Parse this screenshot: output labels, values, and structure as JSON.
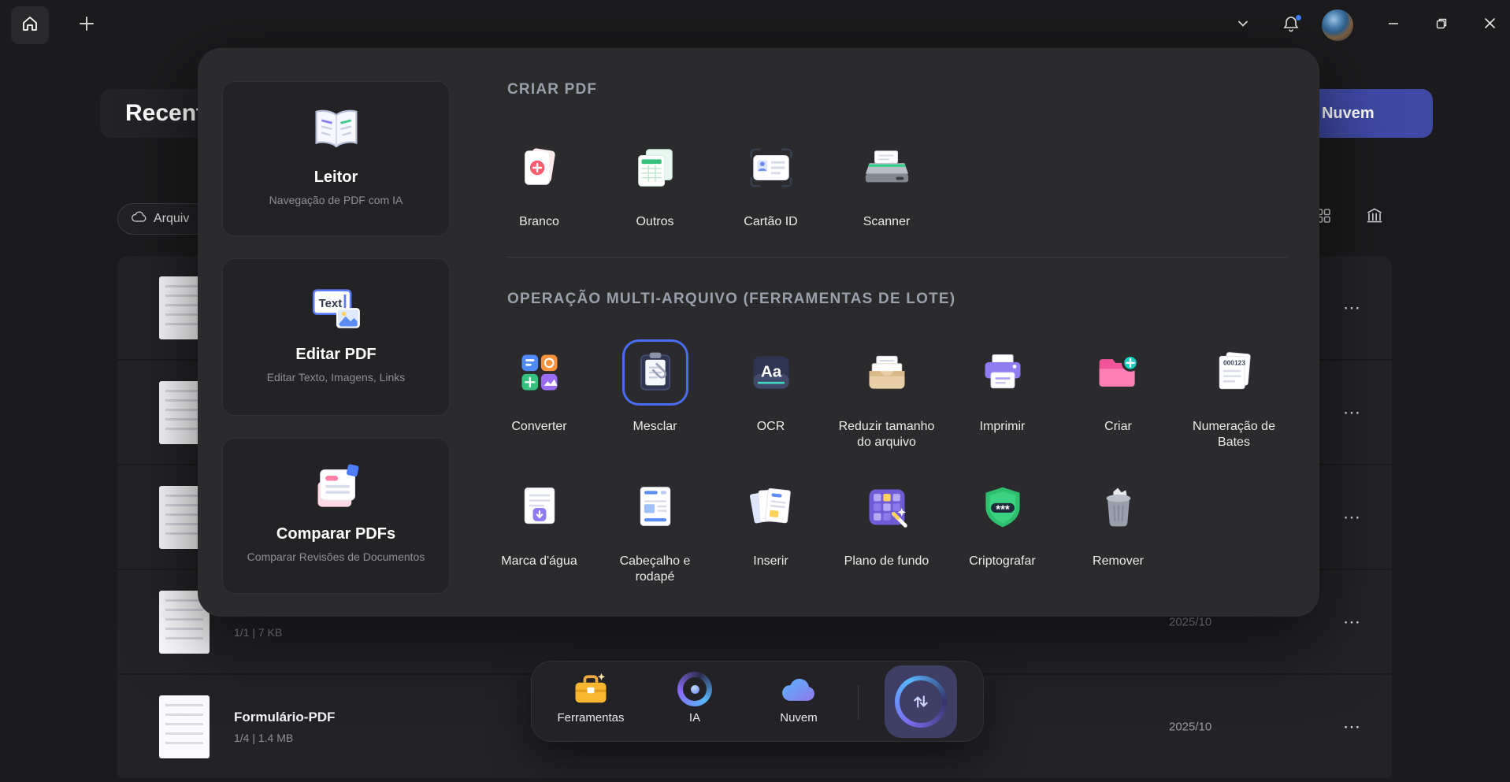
{
  "colors": {
    "accent": "#4a6cf0",
    "cloud_button": "#3e49a3",
    "notification_dot": "#3f7cff"
  },
  "recents": {
    "heading": "Recentes",
    "cloud_button_label": "a Nuvem",
    "filter_label": "Arquiv",
    "menu_glyph": "⋯",
    "files": [
      {
        "name": "",
        "meta": "",
        "date": ""
      },
      {
        "name": "",
        "meta": "",
        "date": ""
      },
      {
        "name": "",
        "meta": "",
        "date": ""
      },
      {
        "name": "",
        "meta": "1/1 | 7 KB",
        "date": "2025/10"
      },
      {
        "name": "Formulário-PDF",
        "meta": "1/4 | 1.4 MB",
        "date": "2025/10"
      }
    ]
  },
  "panel": {
    "cards": [
      {
        "title": "Leitor",
        "subtitle": "Navegação de PDF com IA"
      },
      {
        "title": "Editar PDF",
        "subtitle": "Editar Texto, Imagens, Links"
      },
      {
        "title": "Comparar PDFs",
        "subtitle": "Comparar Revisões de Documentos"
      }
    ],
    "create": {
      "header": "CRIAR PDF",
      "items": [
        {
          "label": "Branco"
        },
        {
          "label": "Outros"
        },
        {
          "label": "Cartão ID"
        },
        {
          "label": "Scanner"
        }
      ]
    },
    "batch": {
      "header": "OPERAÇÃO MULTI-ARQUIVO (FERRAMENTAS DE LOTE)",
      "row1": [
        {
          "label": "Converter"
        },
        {
          "label": "Mesclar",
          "selected": true
        },
        {
          "label": "OCR"
        },
        {
          "label": "Reduzir tamanho do arquivo"
        },
        {
          "label": "Imprimir"
        },
        {
          "label": "Criar"
        },
        {
          "label": "Numeração de Bates"
        }
      ],
      "row2": [
        {
          "label": "Marca d'água"
        },
        {
          "label": "Cabeçalho e rodapé"
        },
        {
          "label": "Inserir"
        },
        {
          "label": "Plano de fundo"
        },
        {
          "label": "Criptografar"
        },
        {
          "label": "Remover"
        }
      ]
    }
  },
  "dock": {
    "items": [
      {
        "label": "Ferramentas"
      },
      {
        "label": "IA"
      },
      {
        "label": "Nuvem"
      }
    ]
  }
}
